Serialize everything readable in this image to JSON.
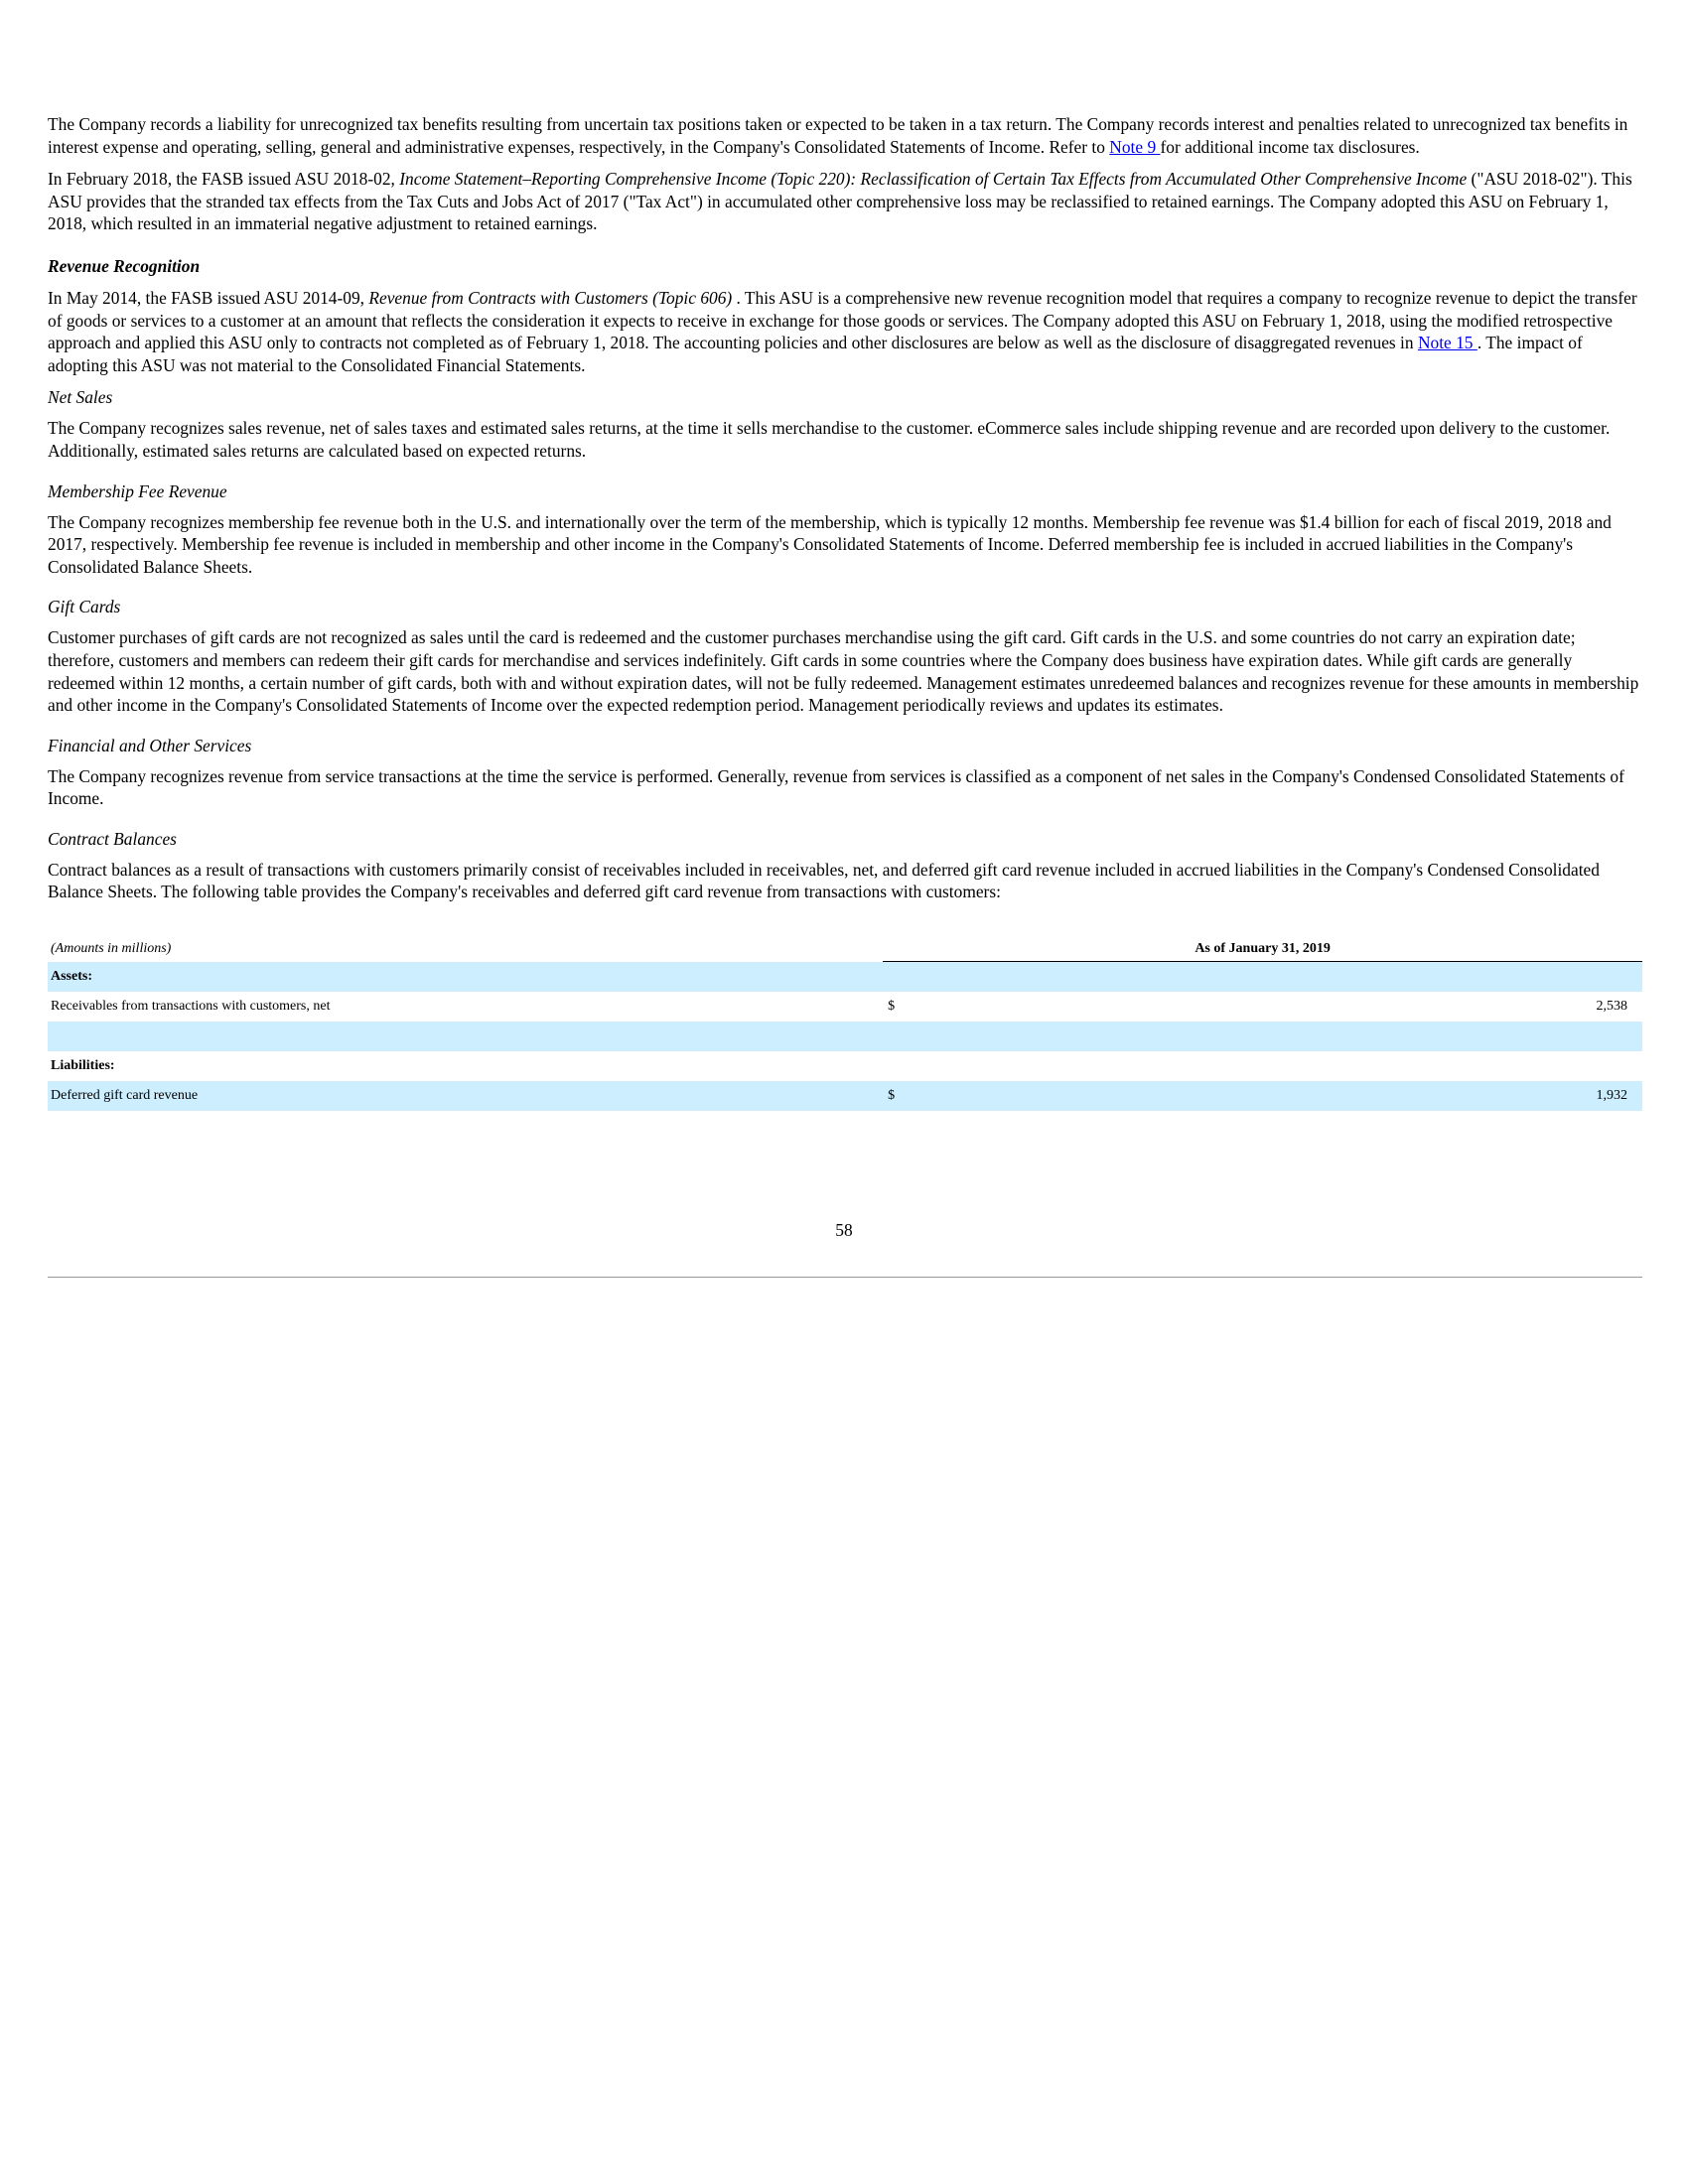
{
  "paragraphs": {
    "p1_text": "The Company records a liability for unrecognized tax benefits resulting from uncertain tax positions taken or expected to be taken in a tax return. The Company records interest and penalties related to unrecognized tax benefits in interest expense and operating, selling, general and administrative expenses, respectively, in the Company's Consolidated Statements of Income. Refer to ",
    "p1_link": "Note 9 ",
    "p1_after": "for additional income tax disclosures.",
    "p2_before": "In February 2018, the FASB issued ASU 2018-02, ",
    "p2_italic": "Income Statement–Reporting Comprehensive Income (Topic 220): Reclassification of Certain Tax Effects from Accumulated Other Comprehensive Income",
    "p2_after": " (\"ASU 2018-02\"). This ASU provides that the stranded tax effects from the Tax Cuts and Jobs Act of 2017 (\"Tax Act\") in accumulated other comprehensive loss may be reclassified to retained earnings. The Company adopted this ASU on February 1, 2018, which resulted in an immaterial negative adjustment to retained earnings."
  },
  "revenue_recognition": {
    "heading": "Revenue Recognition",
    "p_before": "In May 2014, the FASB issued ASU 2014-09, ",
    "p_italic": "Revenue from Contracts with Customers (Topic 606)",
    "p_mid": " . This ASU is a comprehensive new revenue recognition model that requires a company to recognize revenue to depict the transfer of goods or services to a customer at an amount that reflects the consideration it expects to receive in exchange for those goods or services. The Company adopted this ASU on February 1, 2018, using the modified retrospective approach and applied this ASU only to contracts not completed as of February 1, 2018. The accounting policies and other disclosures are below as well as the disclosure of disaggregated revenues in ",
    "p_link": "Note 15 ",
    "p_after": ". The impact of adopting this ASU was not material to the Consolidated Financial Statements."
  },
  "net_sales": {
    "heading": "Net Sales",
    "text": "The Company recognizes sales revenue, net of sales taxes and estimated sales returns, at the time it sells merchandise to the customer. eCommerce sales include shipping revenue and are recorded upon delivery to the customer. Additionally, estimated sales returns are calculated based on expected returns."
  },
  "membership": {
    "heading": "Membership Fee Revenue",
    "text": "The Company recognizes membership fee revenue both in the U.S. and internationally over the term of the membership, which is typically 12 months. Membership fee revenue was $1.4 billion for each of fiscal 2019, 2018 and 2017, respectively. Membership fee revenue is included in membership and other income in the Company's Consolidated Statements of Income. Deferred membership fee is included in accrued liabilities in the Company's Consolidated Balance Sheets."
  },
  "gift_cards": {
    "heading": "Gift Cards",
    "text": "Customer purchases of gift cards are not recognized as sales until the card is redeemed and the customer purchases merchandise using the gift card. Gift cards in the U.S. and some countries do not carry an expiration date; therefore, customers and members can redeem their gift cards for merchandise and services indefinitely. Gift cards in some countries where the Company does business have expiration dates. While gift cards are generally redeemed within 12 months, a certain number of gift cards, both with and without expiration dates, will not be fully redeemed. Management estimates unredeemed balances and recognizes revenue for these amounts in membership and other income in the Company's Consolidated Statements of Income over the expected redemption period. Management periodically reviews and updates its estimates."
  },
  "financial_services": {
    "heading": "Financial and Other Services",
    "text": "The Company recognizes revenue from service transactions at the time the service is performed. Generally, revenue from services is classified as a component of net sales in the Company's Condensed Consolidated Statements of Income."
  },
  "contract_balances": {
    "heading": "Contract Balances",
    "text": "Contract balances as a result of transactions with customers primarily consist of receivables included in receivables, net, and deferred gift card revenue included in accrued liabilities in the Company's Condensed Consolidated Balance Sheets. The following table provides the Company's receivables and deferred gift card revenue from transactions with customers:"
  },
  "table": {
    "caption": "(Amounts in millions)",
    "column_header": "As of January 31, 2019",
    "assets_label": "Assets:",
    "receivables_label": "Receivables from transactions with customers, net",
    "receivables_currency": "$",
    "receivables_value": "2,538",
    "liabilities_label": "Liabilities:",
    "deferred_label": "Deferred gift card revenue",
    "deferred_currency": "$",
    "deferred_value": "1,932"
  },
  "footer": {
    "page_number": "58"
  }
}
